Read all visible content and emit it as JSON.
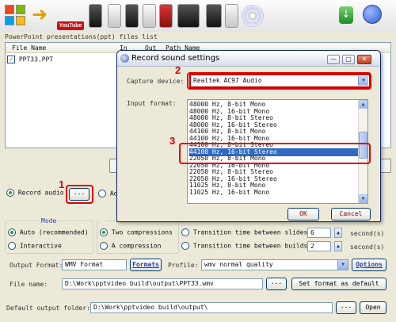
{
  "files": {
    "caption": "PowerPoint presentations(ppt) files list",
    "columns": [
      "File Name",
      "In",
      "Out",
      "Path Name"
    ],
    "rows": [
      {
        "name": "PPT33.PPT",
        "checked": true
      }
    ]
  },
  "record_audio": {
    "label": "Record audio",
    "button": "...",
    "add_label": "Ad"
  },
  "mode": {
    "title": "Mode",
    "auto": "Auto (recommended)",
    "interactive": "Interactive",
    "two_compressions": "Two compressions",
    "one_compression": "A compression"
  },
  "transitions": {
    "slides_label": "Transition time between slides",
    "slides_value": "6",
    "builds_label": "Transition time between builds",
    "builds_value": "2",
    "unit": "second(s)"
  },
  "output_format": {
    "label": "Output Format:",
    "value": "WMV Format",
    "formats_button": "Formats"
  },
  "profile": {
    "label": "Profile:",
    "value": "wmv normal quality",
    "options_button": "Options"
  },
  "file_name": {
    "label": "File name:",
    "value": "D:\\Work\\pptvideo build\\output\\PPT33.wmv",
    "browse": "...",
    "set_default": "Set format as default"
  },
  "output_folder": {
    "label": "Default output folder:",
    "value": "D:\\Work\\pptvideo build\\output\\",
    "browse": "...",
    "open": "Open"
  },
  "dialog": {
    "title": "Record sound settings",
    "capture_label": "Capture device:",
    "capture_value": "Realtek AC97 Audio",
    "input_label": "Input format:",
    "formats": [
      "48000 Hz, 8-bit Mono",
      "48000 Hz, 16-bit Mono",
      "48000 Hz, 8-bit Stereo",
      "48000 Hz, 16-bit Stereo",
      "44100 Hz, 8-bit Mono",
      "44100 Hz, 16-bit Mono",
      "44100 Hz, 8-bit Stereo",
      "44100 Hz, 16-bit Stereo",
      "22050 Hz, 8-bit Mono",
      "22050 Hz, 16-bit Mono",
      "22050 Hz, 8-bit Stereo",
      "22050 Hz, 16-bit Stereo",
      "11025 Hz, 8-bit Mono",
      "11025 Hz, 16-bit Mono"
    ],
    "selected_index": 7,
    "ok": "OK",
    "cancel": "Cancel"
  },
  "toolbar": {
    "youtube_text": "YouTube"
  },
  "callouts": [
    "1",
    "2",
    "3"
  ],
  "colors": {
    "callout": "#e00000",
    "selection": "#316ac5",
    "accent": "#1f3fb0"
  }
}
